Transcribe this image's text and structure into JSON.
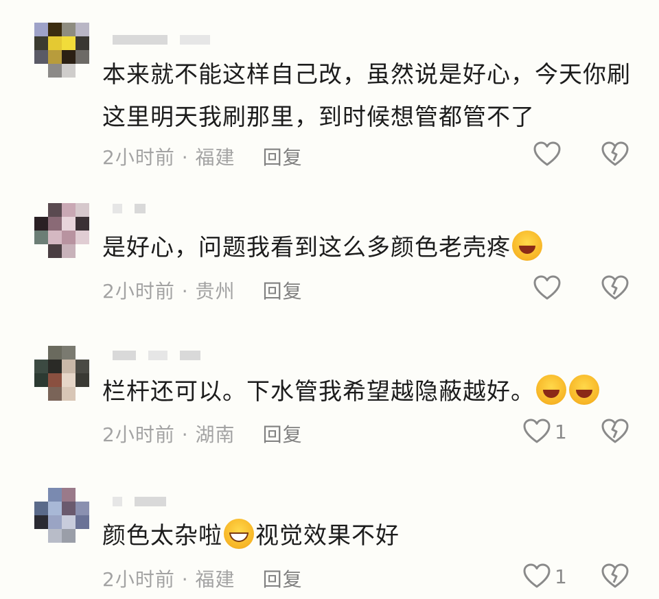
{
  "comments": [
    {
      "text": "本来就不能这样自己改，虽然说是好心，今天你刷这里明天我刷那里，到时候想管都管不了",
      "emoji_after": [],
      "time": "2小时前",
      "location": "福建",
      "reply_label": "回复",
      "like_count": "",
      "avatar_icon": "pixelated-avatar"
    },
    {
      "text": "是好心，问题我看到这么多颜色老壳疼",
      "emoji_after": [
        "laughing-tears-emoji"
      ],
      "time": "2小时前",
      "location": "贵州",
      "reply_label": "回复",
      "like_count": "",
      "avatar_icon": "pixelated-avatar"
    },
    {
      "text": "栏杆还可以。下水管我希望越隐蔽越好。",
      "emoji_after": [
        "laughing-tears-emoji",
        "laughing-tears-emoji"
      ],
      "time": "2小时前",
      "location": "湖南",
      "reply_label": "回复",
      "like_count": "1",
      "avatar_icon": "pixelated-avatar"
    },
    {
      "text_before": "颜色太杂啦",
      "text_after": "视觉效果不好",
      "emoji_inline": "grinning-emoji",
      "time": "2小时前",
      "location": "福建",
      "reply_label": "回复",
      "like_count": "1",
      "avatar_icon": "pixelated-avatar"
    }
  ],
  "separator": "·",
  "colors": {
    "background": "#fdfdf9",
    "text": "#1c1c1c",
    "meta": "#a3a3a3",
    "icon": "#8a8a8a"
  }
}
